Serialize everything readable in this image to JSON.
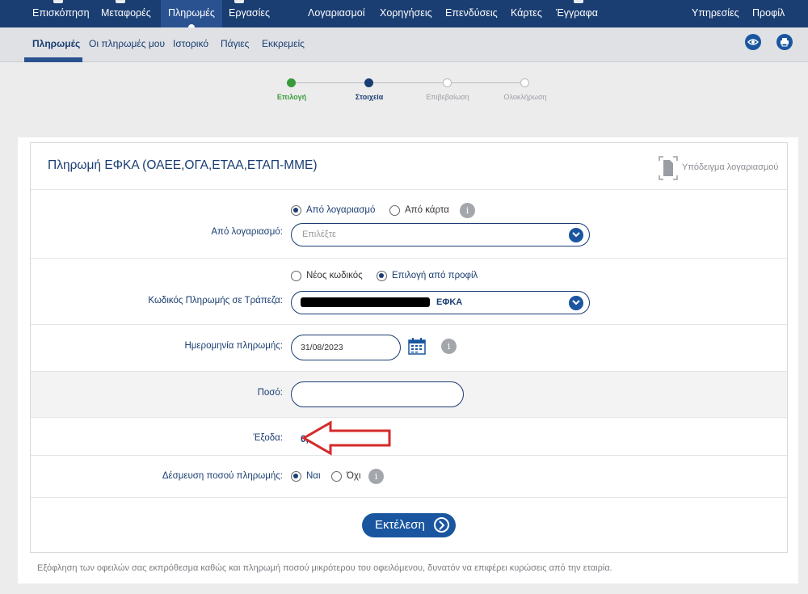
{
  "topnav": {
    "left_items": [
      "Επισκόπηση",
      "Μεταφορές",
      "Πληρωμές",
      "Εργασίες"
    ],
    "active_item": "Πληρωμές",
    "center_items": [
      "Λογαριασμοί",
      "Χορηγήσεις",
      "Επενδύσεις",
      "Κάρτες",
      "Έγγραφα"
    ],
    "right_items": [
      "Υπηρεσίες",
      "Προφίλ"
    ]
  },
  "subnav": {
    "items": [
      "Πληρωμές",
      "Οι πληρωμές μου",
      "Ιστορικό",
      "Πάγιες",
      "Εκκρεμείς"
    ],
    "active_item": "Πληρωμές",
    "right_icons": [
      "eye-icon",
      "printer-icon"
    ]
  },
  "stepper": {
    "steps": [
      {
        "label": "Επιλογή",
        "state": "done"
      },
      {
        "label": "Στοιχεία",
        "state": "current"
      },
      {
        "label": "Επιβεβαίωση",
        "state": "pending"
      },
      {
        "label": "Ολοκλήρωση",
        "state": "pending"
      }
    ]
  },
  "card": {
    "title": "Πληρωμή ΕΦΚΑ (ΟΑΕΕ,ΟΓΑ,ΕΤΑΑ,ΕΤΑΠ-ΜΜΕ)",
    "sample_link": "Υπόδειγμα λογαριασμού",
    "source": {
      "options": [
        {
          "label": "Από λογαριασμό",
          "selected": true
        },
        {
          "label": "Από κάρτα",
          "selected": false
        }
      ],
      "label": "Από λογαριασμό:",
      "select_placeholder": "Επιλέξτε"
    },
    "code": {
      "options": [
        {
          "label": "Νέος κωδικός",
          "selected": false
        },
        {
          "label": "Επιλογή από προφίλ",
          "selected": true
        }
      ],
      "label": "Κωδικός Πληρωμής σε Τράπεζα:",
      "select_value": "ΕΦΚΑ"
    },
    "date": {
      "label": "Ημερομηνία πληρωμής:",
      "value": "31/08/2023"
    },
    "amount": {
      "label": "Ποσό:",
      "value": ""
    },
    "fees": {
      "label": "Έξοδα:",
      "value": "0,30"
    },
    "hold": {
      "label": "Δέσμευση ποσού πληρωμής:",
      "options": [
        {
          "label": "Ναι",
          "selected": true
        },
        {
          "label": "Όχι",
          "selected": false
        }
      ]
    },
    "submit_label": "Εκτέλεση"
  },
  "footnote": "Εξόφληση των οφειλών σας εκπρόθεσμα καθώς και πληρωμή ποσού μικρότερου του οφειλόμενου, δυνατόν να επιφέρει κυρώσεις από την εταιρία.",
  "colors": {
    "nav_bg": "#1a3d72",
    "accent": "#1a56a0",
    "step_done": "#3a9a3a",
    "annotation_arrow": "#d42a2a"
  }
}
